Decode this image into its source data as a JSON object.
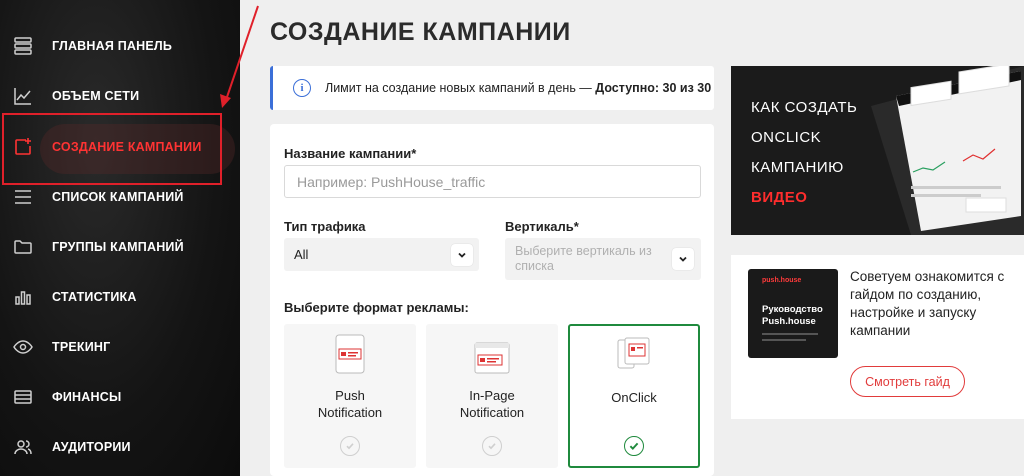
{
  "sidebar": {
    "items": [
      {
        "label": "ГЛАВНАЯ ПАНЕЛЬ",
        "icon": "grid-icon"
      },
      {
        "label": "ОБЪЕМ СЕТИ",
        "icon": "chart-line-icon"
      },
      {
        "label": "СОЗДАНИЕ КАМПАНИИ",
        "icon": "add-campaign-icon",
        "active": true
      },
      {
        "label": "СПИСОК КАМПАНИЙ",
        "icon": "list-icon"
      },
      {
        "label": "ГРУППЫ КАМПАНИЙ",
        "icon": "folder-icon"
      },
      {
        "label": "СТАТИСТИКА",
        "icon": "bar-chart-icon"
      },
      {
        "label": "ТРЕКИНГ",
        "icon": "eye-icon"
      },
      {
        "label": "ФИНАНСЫ",
        "icon": "wallet-icon"
      },
      {
        "label": "АУДИТОРИИ",
        "icon": "users-icon"
      }
    ]
  },
  "page": {
    "title": "СОЗДАНИЕ КАМПАНИИ"
  },
  "info": {
    "text": "Лимит на создание новых кампаний в день — ",
    "strong": "Доступно: 30 из 30"
  },
  "form": {
    "name_label": "Название кампании*",
    "name_placeholder": "Например: PushHouse_traffic",
    "traffic_label": "Тип трафика",
    "traffic_value": "All",
    "vertical_label": "Вертикаль*",
    "vertical_placeholder": "Выберите вертикаль из списка",
    "format_label": "Выберите формат рекламы:",
    "formats": [
      {
        "title": "Push\nNotification",
        "selected": false
      },
      {
        "title": "In-Page\nNotification",
        "selected": false
      },
      {
        "title": "OnClick",
        "selected": true
      }
    ]
  },
  "video_card": {
    "line1": "КАК СОЗДАТЬ",
    "line2": "ONCLICK",
    "line3": "КАМПАНИЮ",
    "cta": "ВИДЕО"
  },
  "guide_card": {
    "thumb_brand": "push.house",
    "thumb_title": "Руководство Push.house",
    "text": "Советуем ознакомится с гайдом по созданию, настройке и запуску кампании",
    "button": "Смотреть гайд"
  },
  "colors": {
    "accent_red": "#e0202a",
    "info_blue": "#3b6fd8",
    "selected_green": "#1f8a3d"
  }
}
